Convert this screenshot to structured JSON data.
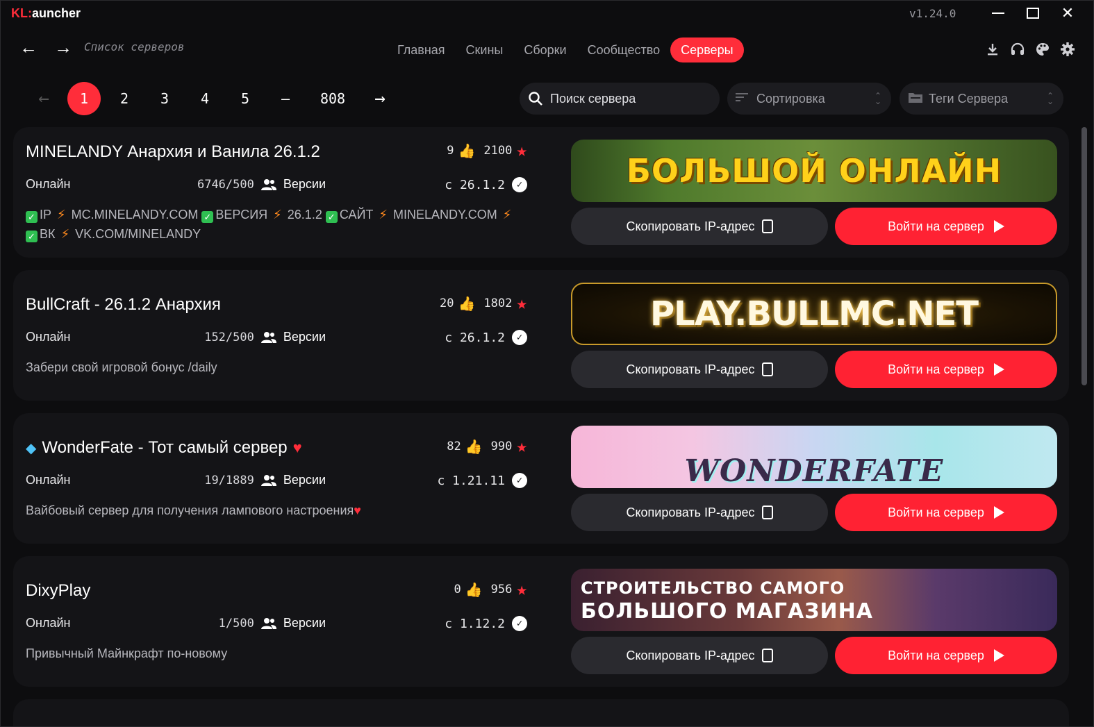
{
  "window": {
    "title_prefix": "KL",
    "title_suffix": "auncher",
    "version": "v1.24.0",
    "minimize_icon": "minimize-icon",
    "maximize_icon": "maximize-icon",
    "close_icon": "close-icon",
    "accent_color": "#ff2d3a"
  },
  "nav": {
    "back_icon": "arrow-left-icon",
    "forward_icon": "arrow-right-icon",
    "breadcrumb": "Список серверов",
    "tabs": [
      {
        "label": "Главная",
        "active": false
      },
      {
        "label": "Скины",
        "active": false
      },
      {
        "label": "Сборки",
        "active": false
      },
      {
        "label": "Сообщество",
        "active": false
      },
      {
        "label": "Серверы",
        "active": true
      }
    ],
    "icons": [
      "download-icon",
      "headset-icon",
      "palette-icon",
      "gear-icon"
    ]
  },
  "pager": {
    "prev": "←",
    "pages": [
      "1",
      "2",
      "3",
      "4",
      "5"
    ],
    "current": "1",
    "ellipsis": "—",
    "last": "808",
    "next": "→"
  },
  "filters": {
    "search_placeholder": "Поиск сервера",
    "sort_label": "Сортировка",
    "tags_label": "Теги Сервера"
  },
  "common": {
    "online_label": "Онлайн",
    "versions_label": "Версии",
    "copy_ip_label": "Скопировать IP-адрес",
    "join_label": "Войти на сервер"
  },
  "servers": [
    {
      "name": "MINELANDY Анархия и Ванила 26.1.2",
      "likes": "9",
      "rating": "2100",
      "players": "6746/500",
      "version": "с 26.1.2",
      "tags": [
        {
          "key": "IP",
          "value": "MC.MINELANDY.COM"
        },
        {
          "key": "ВЕРСИЯ",
          "value": "26.1.2"
        },
        {
          "key": "САЙТ",
          "value": "MINELANDY.COM"
        },
        {
          "key": "ВК",
          "value": "VK.COM/MINELANDY"
        }
      ],
      "banner_text": "БОЛЬШОЙ ОНЛАЙН"
    },
    {
      "name": "BullCraft - 26.1.2 Анархия",
      "likes": "20",
      "rating": "1802",
      "players": "152/500",
      "version": "с 26.1.2",
      "description": "Забери свой игровой бонус /daily",
      "banner_text": "PLAY.BULLMC.NET"
    },
    {
      "name": "WonderFate - Тот самый сервер",
      "name_prefix_icon": "diamond-icon",
      "name_suffix_icon": "heart-icon",
      "likes": "82",
      "rating": "990",
      "players": "19/1889",
      "version": "с 1.21.11",
      "description": "Вайбовый сервер для получения лампового настроения",
      "description_suffix_icon": "heart-icon",
      "banner_text": "WONDERFATE"
    },
    {
      "name": "DixyPlay",
      "likes": "0",
      "rating": "956",
      "players": "1/500",
      "version": "с 1.12.2",
      "description": "Привычный Майнкрафт по-новому",
      "banner_line1": "СТРОИТЕЛЬСТВО САМОГО",
      "banner_line2": "БОЛЬШОГО МАГАЗИНА"
    }
  ]
}
